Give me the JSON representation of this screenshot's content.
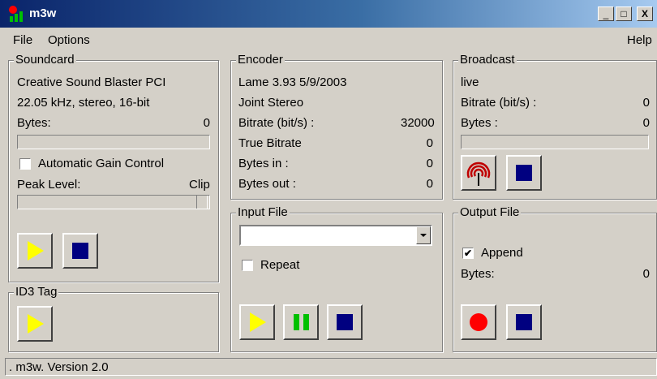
{
  "window": {
    "title": "m3w",
    "minimize": "_",
    "maximize": "□",
    "close": "X"
  },
  "menu": {
    "file": "File",
    "options": "Options",
    "help": "Help"
  },
  "soundcard": {
    "legend": "Soundcard",
    "device": "Creative Sound Blaster PCI",
    "format": "22.05 kHz, stereo, 16-bit",
    "bytes_label": "Bytes:",
    "bytes_value": "0",
    "agc_label": "Automatic Gain Control",
    "agc_checked": false,
    "peak_label": "Peak Level:",
    "clip_label": "Clip"
  },
  "id3": {
    "legend": "ID3 Tag"
  },
  "encoder": {
    "legend": "Encoder",
    "version": "Lame 3.93 5/9/2003",
    "mode": "Joint Stereo",
    "rows": [
      {
        "label": "Bitrate (bit/s) :",
        "value": "32000"
      },
      {
        "label": "True Bitrate",
        "value": "0"
      },
      {
        "label": "Bytes in :",
        "value": "0"
      },
      {
        "label": "Bytes out :",
        "value": "0"
      }
    ]
  },
  "input_file": {
    "legend": "Input File",
    "selected": "",
    "repeat_label": "Repeat",
    "repeat_checked": false
  },
  "broadcast": {
    "legend": "Broadcast",
    "stream": "live",
    "bitrate_label": "Bitrate (bit/s) :",
    "bitrate_value": "0",
    "bytes_label": "Bytes :",
    "bytes_value": "0"
  },
  "output_file": {
    "legend": "Output File",
    "append_label": "Append",
    "append_checked": true,
    "append_mark": "✔",
    "bytes_label": "Bytes:",
    "bytes_value": "0"
  },
  "status": {
    "text": ".  m3w.  Version 2.0"
  },
  "colors": {
    "play": "#ffff00",
    "stop": "#000080",
    "pause": "#00c000",
    "record": "#ff0000",
    "broadcast": "#c00000"
  },
  "icons": [
    "app-icon",
    "play-icon",
    "stop-icon",
    "pause-icon",
    "record-icon",
    "broadcast-icon",
    "dropdown-arrow-icon"
  ]
}
